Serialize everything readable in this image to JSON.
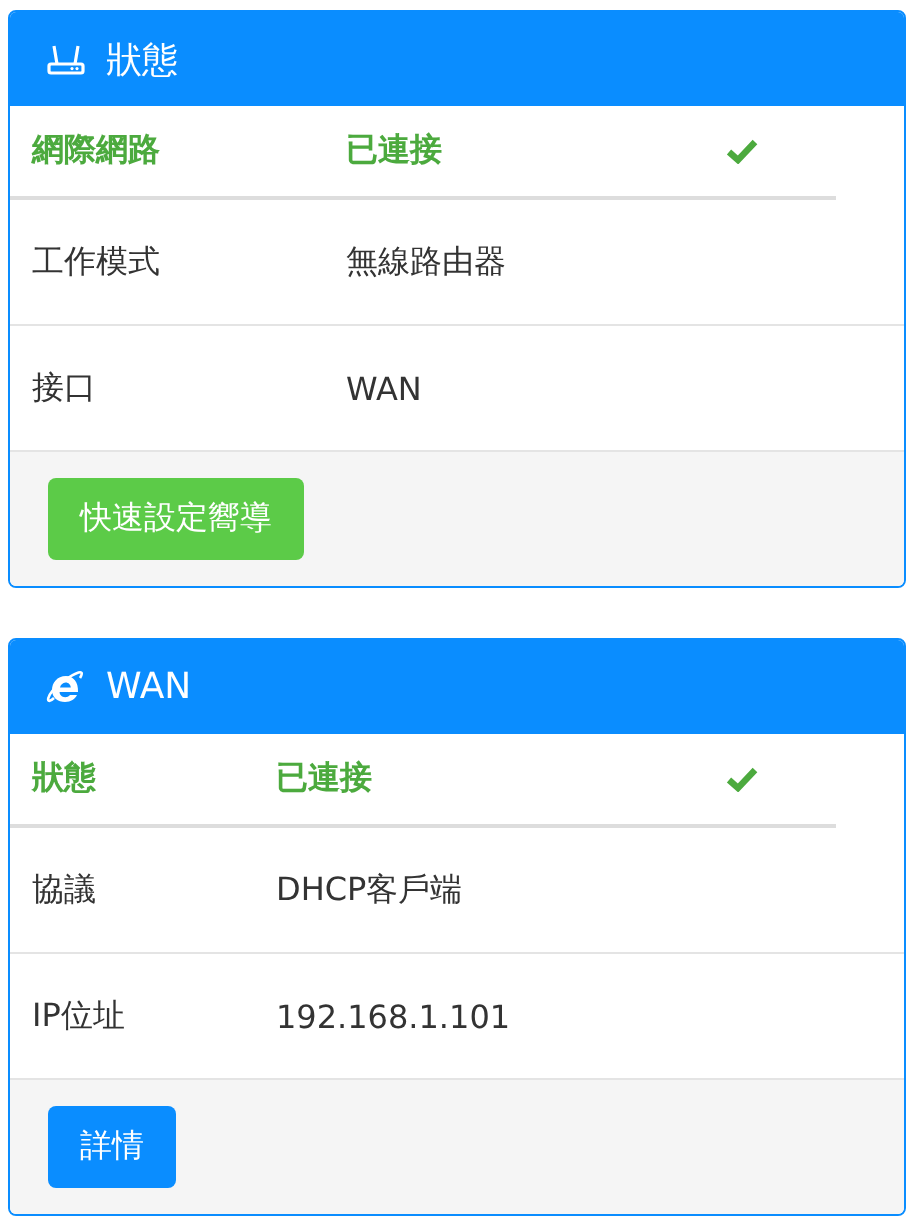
{
  "panels": [
    {
      "kind": "router",
      "title": "狀態",
      "rows": [
        {
          "kind": "status",
          "label": "網際網路",
          "value": "已連接",
          "connected": true
        },
        {
          "kind": "info",
          "label": "工作模式",
          "value": "無線路由器"
        },
        {
          "kind": "info",
          "label": "接口",
          "value": "WAN"
        }
      ],
      "button": {
        "label": "快速設定嚮導",
        "kind": "success"
      }
    },
    {
      "kind": "browser",
      "title": "WAN",
      "rows": [
        {
          "kind": "status",
          "label": "狀態",
          "value": "已連接",
          "connected": true
        },
        {
          "kind": "info",
          "label": "協議",
          "value": "DHCP客戶端"
        },
        {
          "kind": "info",
          "label": "IP位址",
          "value": "192.168.1.101"
        }
      ],
      "button": {
        "label": "詳情",
        "kind": "primary"
      }
    }
  ]
}
